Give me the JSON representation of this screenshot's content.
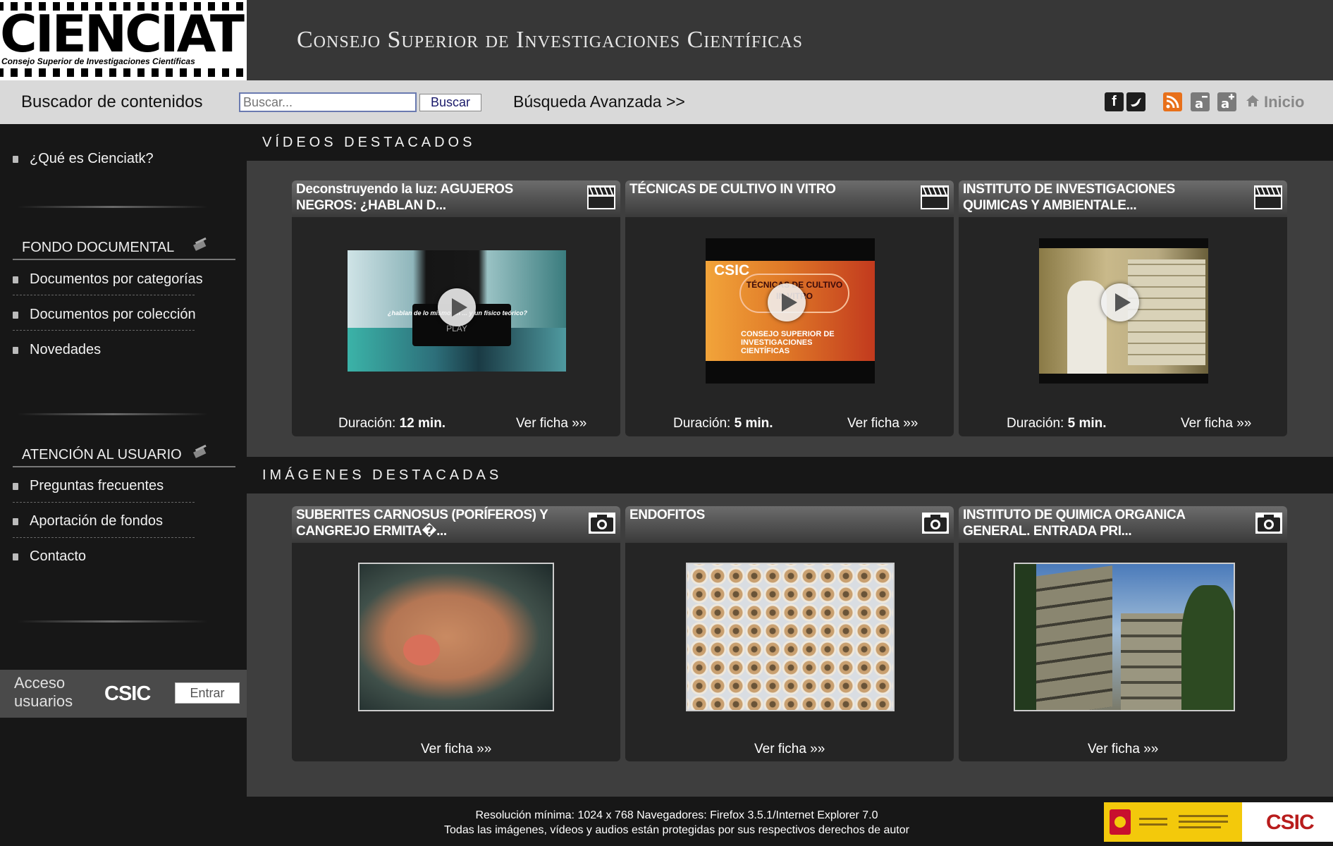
{
  "header": {
    "logo_word": "CIENCIATK",
    "logo_sub": "Consejo Superior de Investigaciones Científicas",
    "site_title": "Consejo Superior de Investigaciones Científicas"
  },
  "search": {
    "label": "Buscador de contenidos",
    "placeholder": "Buscar...",
    "button": "Buscar",
    "advanced": "Búsqueda Avanzada >>",
    "home": "Inicio"
  },
  "sidebar": {
    "top_item": "¿Qué es Cienciatk?",
    "fondo_title": "FONDO DOCUMENTAL",
    "fondo_items": [
      "Documentos por categorías",
      "Documentos por colección",
      "Novedades"
    ],
    "atencion_title": "ATENCIÓN AL USUARIO",
    "atencion_items": [
      "Preguntas frecuentes",
      "Aportación de fondos",
      "Contacto"
    ],
    "access_label_1": "Acceso",
    "access_label_2": "usuarios",
    "access_org": "CSIC",
    "access_button": "Entrar"
  },
  "videos": {
    "section_title": "VÍDEOS DESTACADOS",
    "duration_label": "Duración:",
    "items": [
      {
        "title_1": "Deconstruyendo la luz: AGUJEROS",
        "title_2": "NEGROS: ¿HABLAN D...",
        "duration": "12 min.",
        "link": "Ver ficha »»"
      },
      {
        "title_1": "TÉCNICAS DE CULTIVO IN VITRO",
        "title_2": "",
        "duration": "5 min.",
        "link": "Ver ficha »»"
      },
      {
        "title_1": "INSTITUTO DE INVESTIGACIONES",
        "title_2": "QUIMICAS Y AMBIENTALE...",
        "duration": "5 min.",
        "link": "Ver ficha »»"
      }
    ]
  },
  "images": {
    "section_title": "IMÁGENES DESTACADAS",
    "items": [
      {
        "title_1": "SUBERITES CARNOSUS (PORÍFEROS) Y",
        "title_2": "CANGREJO ERMITA�...",
        "link": "Ver ficha »»"
      },
      {
        "title_1": "ENDOFITOS",
        "title_2": "",
        "link": "Ver ficha »»"
      },
      {
        "title_1": "INSTITUTO DE QUIMICA ORGANICA",
        "title_2": "GENERAL. ENTRADA PRI...",
        "link": "Ver ficha »»"
      }
    ]
  },
  "thumb_text": {
    "v1_sub": "¿hablan de lo mismo un ... y un físico teórico?",
    "v1_play": "PLAY",
    "v2_csic": "CSIC",
    "v2_org": "CONSEJO SUPERIOR DE INVESTIGACIONES CIENTÍFICAS",
    "v2_tech": "TÉCNICAS DE CULTIVO IN VITRO"
  },
  "footer": {
    "line1": "Resolución mínima: 1024 x 768 Navegadores: Firefox 3.5.1/Internet Explorer 7.0",
    "line2": "Todas las imágenes, vídeos y audios están protegidas por sus respectivos derechos de autor",
    "gov_org": "CSIC"
  },
  "colors": {
    "header_bg": "#373737",
    "search_bg": "#d9d9d9",
    "sidebar_bg": "#171717",
    "main_bg": "#3e3e3e",
    "rss": "#e8701a",
    "csic_red": "#b81c1c"
  },
  "icons": [
    "facebook-icon",
    "twitter-icon",
    "rss-icon",
    "font-decrease-icon",
    "font-increase-icon",
    "home-icon",
    "clapperboard-icon",
    "camera-icon",
    "play-icon",
    "bullet-icon"
  ]
}
